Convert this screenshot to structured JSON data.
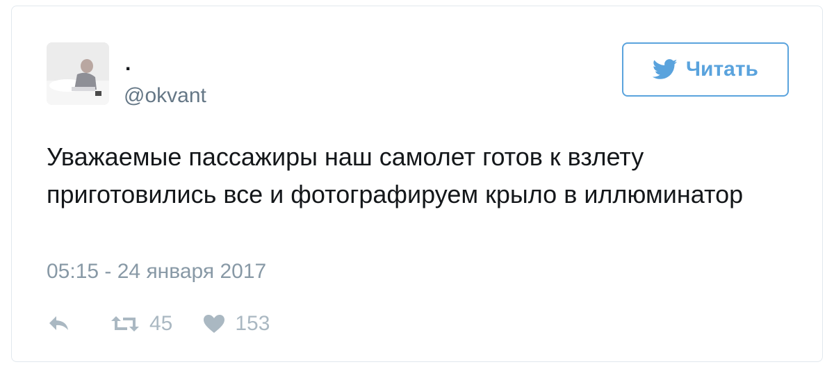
{
  "user": {
    "display_name": ".",
    "handle": "@okvant"
  },
  "follow_button": {
    "label": "Читать",
    "icon": "twitter-bird-icon",
    "color": "#5aa3dd"
  },
  "tweet": {
    "text": "Уважаемые пассажиры наш самолет готов к взлету приготовились все и фотографируем крыло в иллюминатор",
    "timestamp": "05:15 - 24 января 2017"
  },
  "actions": {
    "reply_icon": "reply-icon",
    "retweet_icon": "retweet-icon",
    "retweet_count": "45",
    "like_icon": "heart-icon",
    "like_count": "153"
  }
}
